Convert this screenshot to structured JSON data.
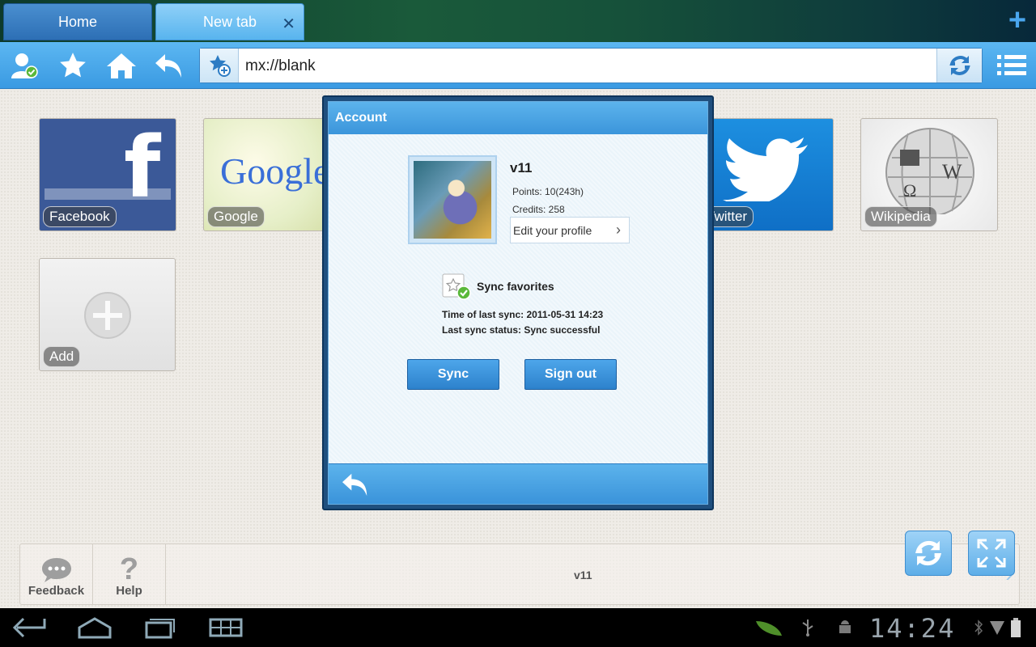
{
  "tabs": [
    {
      "label": "Home"
    },
    {
      "label": "New tab"
    }
  ],
  "toolbar": {
    "icons": [
      "account-icon",
      "favorites-star-icon",
      "home-icon",
      "back-icon",
      "add-bookmark-icon",
      "refresh-icon",
      "menu-icon"
    ]
  },
  "address_bar": {
    "value": "mx://blank"
  },
  "speed_dial": {
    "tiles": [
      {
        "label": "Facebook"
      },
      {
        "label": "Google"
      },
      {
        "label": "Twitter"
      },
      {
        "label": "Wikipedia"
      },
      {
        "label": "Add"
      }
    ],
    "facebook_glyph": "f",
    "google_logo": "Google"
  },
  "bottom_panel": {
    "feedback_label": "Feedback",
    "help_label": "Help",
    "version": "v11"
  },
  "dialog": {
    "title": "Account",
    "username": "v11",
    "points": "Points: 10(243h)",
    "credits": "Credits: 258",
    "edit_profile": "Edit your profile",
    "sync_favorites": "Sync favorites",
    "last_sync_time": "Time of last sync: 2011-05-31 14:23",
    "last_sync_status": "Last sync status: Sync successful",
    "sync_button": "Sync",
    "sign_out_button": "Sign out"
  },
  "system_bar": {
    "clock": "14:24"
  },
  "colors": {
    "accent_blue": "#3a9ae2",
    "dialog_frame": "#1f4f7e",
    "facebook": "#3b5998",
    "twitter": "#1d8fe0",
    "sync_ok_green": "#5ab83a"
  }
}
